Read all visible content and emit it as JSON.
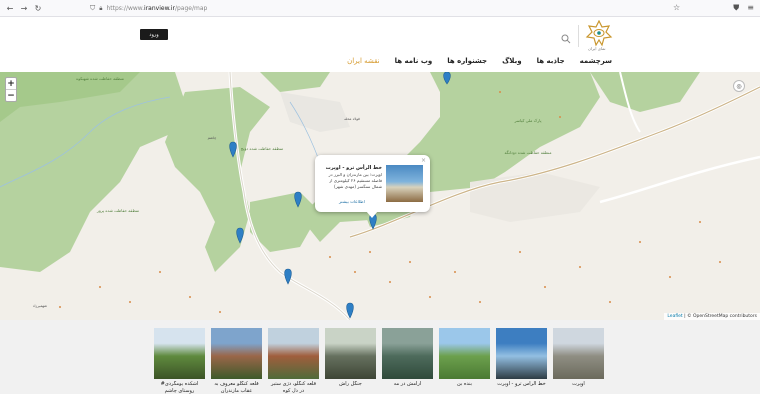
{
  "browser": {
    "url_prefix": "https://www.",
    "url_domain": "iranview.ir",
    "url_path": "/page/map"
  },
  "header": {
    "login_label": "ورود",
    "logo_text": "نمای ایران",
    "menu": [
      {
        "label": "سرچشمه",
        "active": false
      },
      {
        "label": "جاذبه ها",
        "active": false
      },
      {
        "label": "وبلاگ",
        "active": false
      },
      {
        "label": "جشنواره ها",
        "active": false
      },
      {
        "label": "وب نامه ها",
        "active": false
      },
      {
        "label": "نقشه ایران",
        "active": true
      }
    ]
  },
  "map": {
    "zoom_in": "+",
    "zoom_out": "−",
    "attribution_link": "Leaflet",
    "attribution_text": " | © OpenStreetMap contributors",
    "popup": {
      "title": "خط الرأس ترو - اوپرت",
      "description": "اوپرت؛ بین مازندران و البرز در فاصله مستقیم ۲۶ کیلومتری از شمال سنگسر (مهدی شهر)",
      "link": "اطلاعات بیشتر",
      "close": "×"
    },
    "place_labels": [
      "پارک ملی کیاسر",
      "منطقه حفاظت شده شهبکوه",
      "منطقه حفاظت شده دودانگه",
      "منطقه حفاظت شده دوبج",
      "منطقه حفاظت شده پرور",
      "فولاد محله",
      "چاشم",
      "شهمیرزاد"
    ],
    "colors": {
      "forest": "#b5d29f",
      "forest_dark": "#a5c98b",
      "land": "#f2efe9",
      "road": "#ffffff",
      "marker": "#2e7fc5"
    }
  },
  "gallery": {
    "items": [
      {
        "label": "اوپرت",
        "colors": [
          "#cfd7df",
          "#8f8e83",
          "#6b6a5c"
        ]
      },
      {
        "label": "خط الرأس ترو - اوپرت",
        "colors": [
          "#3d7ec1",
          "#93bfe2",
          "#2e3c44"
        ]
      },
      {
        "label": "بنده بن",
        "colors": [
          "#9bc7ea",
          "#6ca04d",
          "#4b7a33"
        ]
      },
      {
        "label": "آرامش در مه",
        "colors": [
          "#8aa198",
          "#4e6b5c",
          "#2f4a3b"
        ]
      },
      {
        "label": "جنگل راش",
        "colors": [
          "#c9d3c6",
          "#66715f",
          "#3e4535"
        ]
      },
      {
        "label": "قلعه کنگلو، دژی ستبر در دل کوه",
        "colors": [
          "#c0d1de",
          "#a05e3d",
          "#4f6b3a"
        ]
      },
      {
        "label": "قلعه کنگلو معروف به عقاب مازندران",
        "colors": [
          "#7ea4cc",
          "#9a6649",
          "#3d5a2a"
        ]
      },
      {
        "label": "#آشکده یومگردی روستای چاشم",
        "colors": [
          "#d6e3ee",
          "#5f8a3e",
          "#3c5326"
        ]
      }
    ]
  }
}
